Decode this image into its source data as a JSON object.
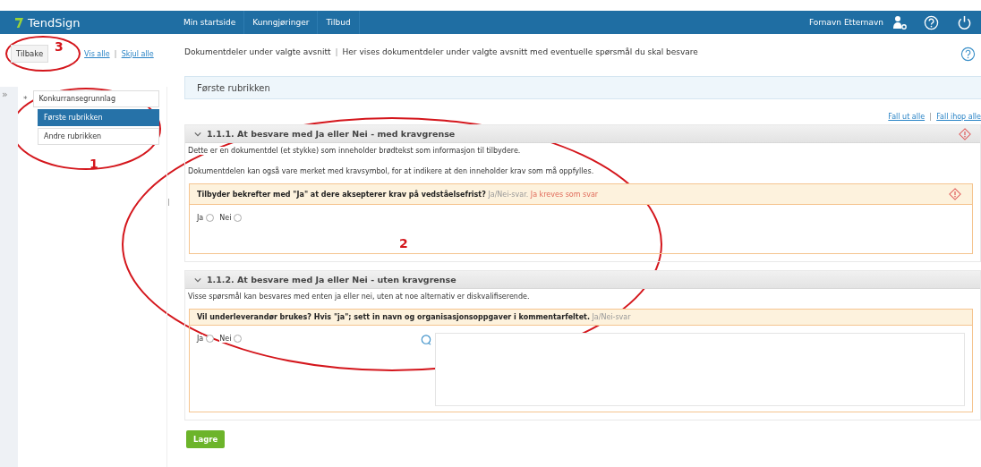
{
  "app": {
    "logo": "TendSign"
  },
  "nav": [
    {
      "label": "Min startside",
      "selected": false
    },
    {
      "label": "Kunngjøringer",
      "selected": false
    },
    {
      "label": "Tilbud",
      "selected": false
    }
  ],
  "user": {
    "name": "Fornavn Etternavn"
  },
  "sidebar": {
    "back_button": "Tilbake",
    "links": [
      "Vis alle",
      "Skjul alle"
    ],
    "link_separator": "|",
    "expand_handle": "»",
    "tree": [
      {
        "label": "Konkurransegrunnlag",
        "marker": "*",
        "selected": false,
        "children": [
          {
            "label": "Første rubrikken",
            "selected": true
          },
          {
            "label": "Andre rubrikken",
            "selected": false
          }
        ]
      }
    ]
  },
  "header": {
    "title": "Dokumentdeler under valgte avsnitt",
    "separator": "|",
    "description": "Her vises dokumentdeler under valgte avsnitt med eventuelle spørsmål du skal besvare"
  },
  "section_title": "Første rubrikken",
  "collapse_links": [
    "Fall ut alle",
    "Fall ihop alle"
  ],
  "collapse_separator": "|",
  "parts": [
    {
      "title": "1.1.1. At besvare med Ja eller Nei - med kravgrense",
      "requirement": true,
      "expanded": true,
      "paragraphs": [
        "Dette er en dokumentdel (et stykke) som inneholder brødtekst som informasjon til tilbydere.",
        "Dokumentdelen kan også vare merket med kravsymbol, for at indikere at den inneholder krav som må oppfylles."
      ],
      "question": {
        "text": "Tilbyder bekrefter med \"Ja\" at dere aksepterer krav på vedståelsefrist?",
        "type_label": "Ja/Nei-svar.",
        "requirement_text": "Ja kreves som svar",
        "requirement": true,
        "comment": false,
        "options": [
          {
            "label": "Ja",
            "selected": false
          },
          {
            "label": "Nei",
            "selected": false
          }
        ]
      }
    },
    {
      "title": "1.1.2. At besvare med Ja eller Nei - uten kravgrense",
      "requirement": false,
      "expanded": true,
      "paragraphs": [
        "Visse spørsmål kan besvares med enten ja eller nei, uten at noe alternativ er diskvalifiserende."
      ],
      "question": {
        "text": "Vil underleverandør brukes? Hvis \"ja\"; sett in navn og organisasjonsoppgaver i kommentarfeltet.",
        "type_label": "Ja/Nei-svar",
        "requirement": false,
        "comment": true,
        "options": [
          {
            "label": "Ja",
            "selected": false
          },
          {
            "label": "Nei",
            "selected": false
          }
        ]
      }
    }
  ],
  "save_button": "Lagre",
  "annotations": [
    {
      "label": "1"
    },
    {
      "label": "2"
    },
    {
      "label": "3"
    }
  ]
}
